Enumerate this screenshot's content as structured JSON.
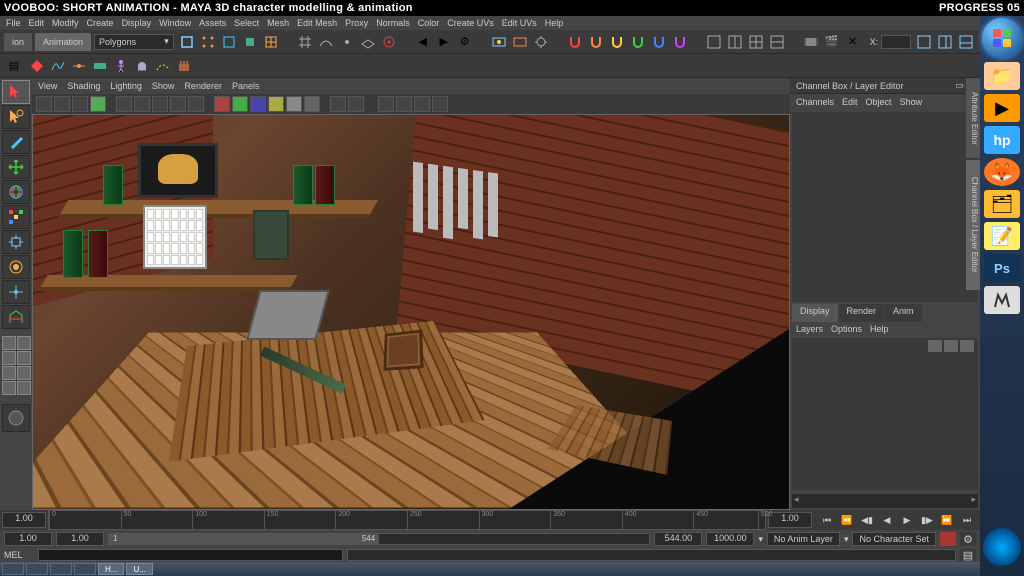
{
  "header": {
    "title": "VOOBOO: SHORT ANIMATION - MAYA 3D character modelling & animation",
    "progress": "PROGRESS 05"
  },
  "menubar": [
    "File",
    "Edit",
    "Modify",
    "Create",
    "Display",
    "Window",
    "Assets",
    "Select",
    "Mesh",
    "Edit Mesh",
    "Proxy",
    "Normals",
    "Color",
    "Create UVs",
    "Edit UVs",
    "Help"
  ],
  "shelf": {
    "mode_tab": "ion",
    "anim_tab": "Animation",
    "component_sel": "Polygons",
    "x_label": "X:"
  },
  "viewport_menu": [
    "View",
    "Shading",
    "Lighting",
    "Show",
    "Renderer",
    "Panels"
  ],
  "channel_box": {
    "title": "Channel Box / Layer Editor",
    "menu": [
      "Channels",
      "Edit",
      "Object",
      "Show"
    ],
    "tabs": [
      "Display",
      "Render",
      "Anim"
    ],
    "sub": [
      "Layers",
      "Options",
      "Help"
    ],
    "vtab1": "Attribute Editor",
    "vtab2": "Channel Box / Layer Editor"
  },
  "timeline": {
    "ticks": [
      "0",
      "50",
      "100",
      "150",
      "200",
      "250",
      "300",
      "350",
      "400",
      "450",
      "500"
    ],
    "cur": "1.00",
    "end_field": "1.00"
  },
  "range": {
    "start": "1.00",
    "in": "1.00",
    "slider_start": "1",
    "slider_end": "544",
    "out": "544.00",
    "end": "1000.00",
    "layer": "No Anim Layer",
    "charset": "No Character Set"
  },
  "cmd": {
    "label": "MEL"
  },
  "wintb": {
    "app1": "H...",
    "app2": "U..."
  }
}
